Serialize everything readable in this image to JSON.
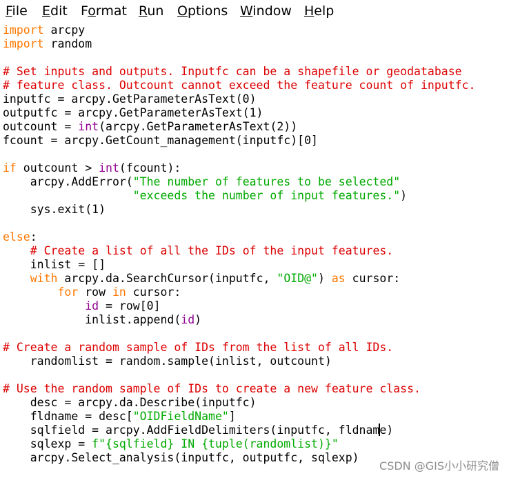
{
  "colors": {
    "keyword": "#ff7700",
    "builtin": "#900090",
    "string": "#00aa00",
    "comment": "#dd0000",
    "default": "#000000",
    "watermark": "#8e8e8e"
  },
  "menu": [
    {
      "label": "File",
      "mnemonic": "F"
    },
    {
      "label": "Edit",
      "mnemonic": "E"
    },
    {
      "label": "Format",
      "mnemonic": "o"
    },
    {
      "label": "Run",
      "mnemonic": "R"
    },
    {
      "label": "Options",
      "mnemonic": "O"
    },
    {
      "label": "Window",
      "mnemonic": "W"
    },
    {
      "label": "Help",
      "mnemonic": "H"
    }
  ],
  "code_lines": [
    [
      {
        "t": "import",
        "c": "keyword"
      },
      {
        "t": " arcpy",
        "c": "default"
      }
    ],
    [
      {
        "t": "import",
        "c": "keyword"
      },
      {
        "t": " random",
        "c": "default"
      }
    ],
    [],
    [
      {
        "t": "# Set inputs and outputs. Inputfc can be a shapefile or geodatabase",
        "c": "comment"
      }
    ],
    [
      {
        "t": "# feature class. Outcount cannot exceed the feature count of inputfc.",
        "c": "comment"
      }
    ],
    [
      {
        "t": "inputfc = arcpy.GetParameterAsText(0)",
        "c": "default"
      }
    ],
    [
      {
        "t": "outputfc = arcpy.GetParameterAsText(1)",
        "c": "default"
      }
    ],
    [
      {
        "t": "outcount = ",
        "c": "default"
      },
      {
        "t": "int",
        "c": "builtin"
      },
      {
        "t": "(arcpy.GetParameterAsText(2))",
        "c": "default"
      }
    ],
    [
      {
        "t": "fcount = arcpy.GetCount_management(inputfc)[0]",
        "c": "default"
      }
    ],
    [],
    [
      {
        "t": "if",
        "c": "keyword"
      },
      {
        "t": " outcount > ",
        "c": "default"
      },
      {
        "t": "int",
        "c": "builtin"
      },
      {
        "t": "(fcount):",
        "c": "default"
      }
    ],
    [
      {
        "t": "    arcpy.AddError(",
        "c": "default"
      },
      {
        "t": "\"The number of features to be selected\"",
        "c": "string"
      }
    ],
    [
      {
        "t": "                   ",
        "c": "default"
      },
      {
        "t": "\"exceeds the number of input features.\"",
        "c": "string"
      },
      {
        "t": ")",
        "c": "default"
      }
    ],
    [
      {
        "t": "    sys.exit(1)",
        "c": "default"
      }
    ],
    [],
    [
      {
        "t": "else",
        "c": "keyword"
      },
      {
        "t": ":",
        "c": "default"
      }
    ],
    [
      {
        "t": "    ",
        "c": "default"
      },
      {
        "t": "# Create a list of all the IDs of the input features.",
        "c": "comment"
      }
    ],
    [
      {
        "t": "    inlist = []",
        "c": "default"
      }
    ],
    [
      {
        "t": "    ",
        "c": "default"
      },
      {
        "t": "with",
        "c": "keyword"
      },
      {
        "t": " arcpy.da.SearchCursor(inputfc, ",
        "c": "default"
      },
      {
        "t": "\"OID@\"",
        "c": "string"
      },
      {
        "t": ") ",
        "c": "default"
      },
      {
        "t": "as",
        "c": "keyword"
      },
      {
        "t": " cursor:",
        "c": "default"
      }
    ],
    [
      {
        "t": "        ",
        "c": "default"
      },
      {
        "t": "for",
        "c": "keyword"
      },
      {
        "t": " row ",
        "c": "default"
      },
      {
        "t": "in",
        "c": "keyword"
      },
      {
        "t": " cursor:",
        "c": "default"
      }
    ],
    [
      {
        "t": "            ",
        "c": "default"
      },
      {
        "t": "id",
        "c": "builtin"
      },
      {
        "t": " = row[0]",
        "c": "default"
      }
    ],
    [
      {
        "t": "            inlist.append(",
        "c": "default"
      },
      {
        "t": "id",
        "c": "builtin"
      },
      {
        "t": ")",
        "c": "default"
      }
    ],
    [],
    [
      {
        "t": "# Create a random sample of IDs from the list of all IDs.",
        "c": "comment"
      }
    ],
    [
      {
        "t": "    randomlist = random.sample(inlist, outcount)",
        "c": "default"
      }
    ],
    [],
    [
      {
        "t": "# Use the random sample of IDs to create a new feature class.",
        "c": "comment"
      }
    ],
    [
      {
        "t": "    desc = arcpy.da.Describe(inputfc)",
        "c": "default"
      }
    ],
    [
      {
        "t": "    fldname = desc[",
        "c": "default"
      },
      {
        "t": "\"OIDFieldName\"",
        "c": "string"
      },
      {
        "t": "]",
        "c": "default"
      }
    ],
    [
      {
        "t": "    sqlfield = arcpy.AddFieldDelimiters(inputfc, fldnam",
        "c": "default"
      },
      {
        "t": "",
        "c": "caret"
      },
      {
        "t": "e)",
        "c": "default"
      }
    ],
    [
      {
        "t": "    sqlexp = ",
        "c": "default"
      },
      {
        "t": "f\"{sqlfield} IN {tuple(randomlist)}\"",
        "c": "string"
      }
    ],
    [
      {
        "t": "    arcpy.Select_analysis(inputfc, outputfc, sqlexp)",
        "c": "default"
      }
    ]
  ],
  "watermark": "CSDN @GIS小小研究僧"
}
